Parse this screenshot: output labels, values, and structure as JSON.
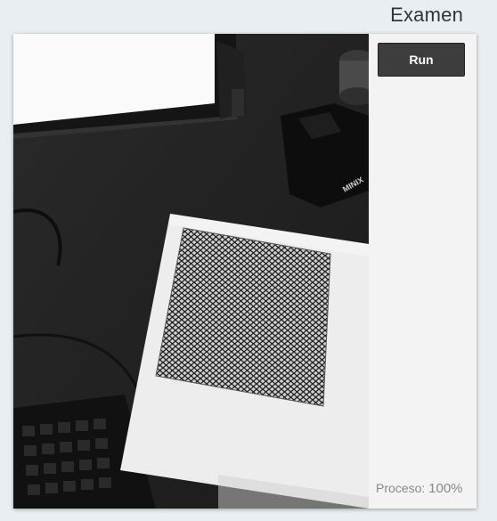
{
  "header": {
    "title": "Examen"
  },
  "actions": {
    "run_label": "Run"
  },
  "status": {
    "progress_label": "Proceso:",
    "progress_value": "100%"
  },
  "camera": {
    "keyboard_brand": "MINIX"
  }
}
